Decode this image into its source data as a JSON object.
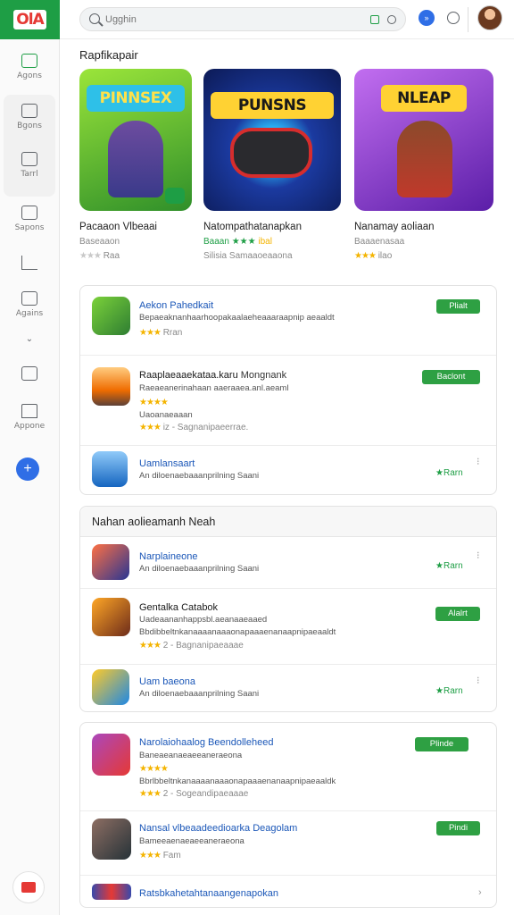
{
  "logo": "OlA",
  "rail": {
    "items": [
      {
        "label": "Agons",
        "icon": "games-icon"
      },
      {
        "label": "Bgons",
        "icon": "apps-icon"
      },
      {
        "label": "Tarrl",
        "icon": "movies-icon"
      },
      {
        "label": "Sapons",
        "icon": "books-icon"
      },
      {
        "label": "",
        "icon": "trending-icon"
      },
      {
        "label": "Agains",
        "icon": "library-icon"
      },
      {
        "label": "",
        "icon": "chevron-down-icon"
      },
      {
        "label": "",
        "icon": "offers-icon"
      },
      {
        "label": "Appone",
        "icon": "home-icon"
      }
    ],
    "fab_label": "+"
  },
  "search": {
    "placeholder": "Ugghin"
  },
  "featured": {
    "title": "Rapfikapair",
    "cards": [
      {
        "banner": "PINNSEX",
        "name": "Pacaaon Vlbeaai",
        "sub": "Baseaaon",
        "rating_stars": "★★★",
        "rating_text": "Raa",
        "colors": [
          "#8ddc2c",
          "#3e9a2a"
        ]
      },
      {
        "banner": "PUNSNS",
        "name": "Natompathatanapkan",
        "sub_stars": "Baaan ★★★",
        "sub_tail": "ibal",
        "sub2": "Silisia Samaaoeaaona",
        "colors": [
          "#1b3aa0",
          "#0c1a55"
        ]
      },
      {
        "banner": "NLEAP",
        "name": "Nanamay aoliaan",
        "sub": "Baaaenasaa",
        "rating_stars": "★★★",
        "rating_text": "ilao",
        "colors": [
          "#a64ce0",
          "#5b1ea8"
        ]
      }
    ]
  },
  "list1": {
    "rows": [
      {
        "title": "Aekon Pahedkait",
        "text": "Bepaeaknanhaarhoopakaalaeheaaaraapnip aeaaldt",
        "stars": "★★★",
        "tail": "Rran",
        "action": "Plialt",
        "action_kind": "button",
        "colors": [
          "#4caf50",
          "#2e7d32"
        ]
      },
      {
        "title": "Raaplaeaaekataa.karu",
        "title_tail": "Mongnank",
        "text": "Raeaeanerinahaan aaeraaea.anl.aeaml",
        "text2": "Uaoanaeaaan",
        "stars": "★★★★",
        "stars2": "★★★",
        "tail": "iz - Sagnanipaeerrae.",
        "action": "Baclont",
        "action_kind": "button",
        "colors": [
          "#ffb74d",
          "#c62828"
        ]
      },
      {
        "title": "Uamlansaart",
        "text": "An diloenaebaaanprilning Saani",
        "action": "Rarn",
        "action_kind": "link",
        "colors": [
          "#64b5f6",
          "#1565c0"
        ]
      }
    ]
  },
  "list2": {
    "title": "Nahan aolieamanh Neah",
    "rows": [
      {
        "title": "Narplaineone",
        "text": "An diloenaebaaanprilning Saani",
        "action": "Rarn",
        "action_kind": "link",
        "colors": [
          "#ff7043",
          "#283593"
        ]
      },
      {
        "title": "Gentalka Catabok",
        "text": "Uadeaananhappsbl.aeanaaeaaed",
        "text2": "Bbdibbeltnkanaaaanaaaonapaaaenanaapnipaeaaldt",
        "stars": "★★★",
        "tail": "2 - Bagnanipaeaaae",
        "action": "Alalrt",
        "action_kind": "button",
        "colors": [
          "#ef6c00",
          "#4e342e"
        ]
      },
      {
        "title": "Uam baeona",
        "text": "An diloenaebaaanprilning Saani",
        "action": "Rarn",
        "action_kind": "link",
        "colors": [
          "#ffca28",
          "#1e88e5"
        ]
      }
    ]
  },
  "list3": {
    "rows": [
      {
        "title": "Narolaiohaalog Beendolleheed",
        "text": "Baneaeanaeaeeaneraeona",
        "stars": "★★★★",
        "stars2": "★★★",
        "tail": "2 - Sogeandipaeaaae",
        "text2": "Bbrlbbeltnkanaaaanaaaonapaaaenanaapnipaeaaldk",
        "action": "Plinde",
        "action_kind": "button",
        "colors": [
          "#ab47bc",
          "#e53935"
        ]
      },
      {
        "title": "Nansal vlbeaadeedioarka Deagolam",
        "text": "Bameeaenaeaeeaneraeona",
        "stars": "★★★",
        "tail": "Fam",
        "action": "Pindi",
        "action_kind": "button",
        "colors": [
          "#795548",
          "#263238"
        ]
      },
      {
        "title": "Ratsbkahetahtanaangenapokan",
        "action": "",
        "action_kind": "chevron",
        "colors": [
          "#3949ab",
          "#e53935"
        ]
      }
    ]
  }
}
